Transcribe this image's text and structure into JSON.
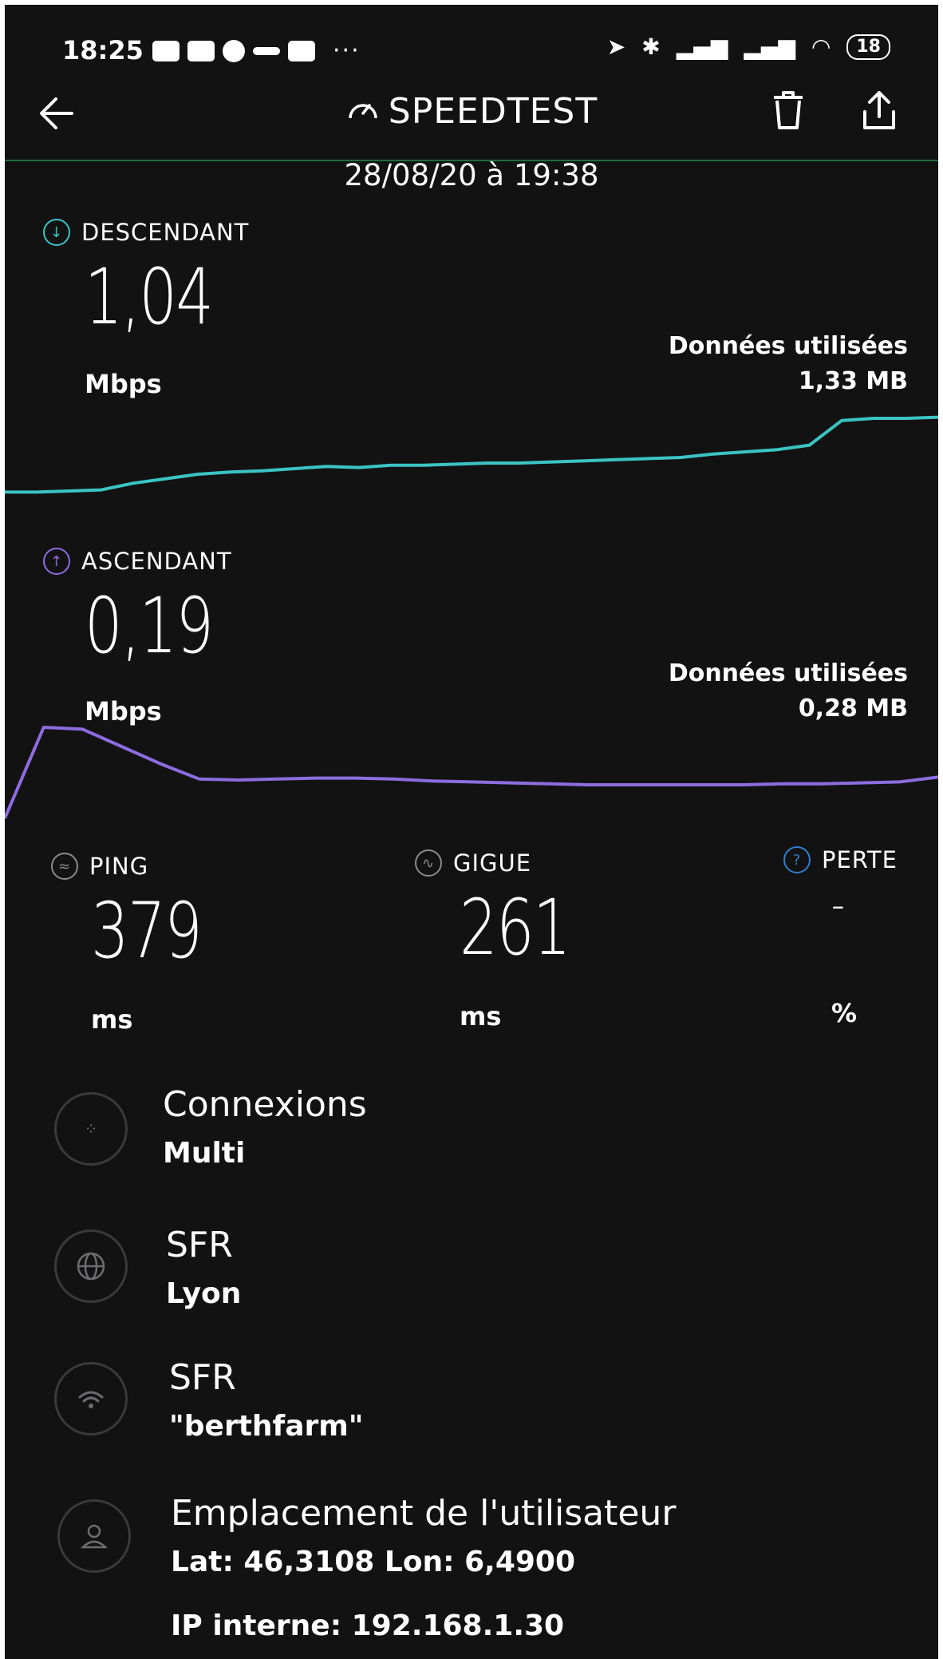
{
  "status_bar": {
    "time": "18:25",
    "notification_icons": [
      "message-icon",
      "youtube-icon",
      "app-icon",
      "app-icon",
      "gmail-icon"
    ],
    "more": "···",
    "right_icons": [
      "location-icon",
      "bluetooth-icon",
      "signal-icon",
      "signal-icon",
      "wifi-icon"
    ],
    "battery": "18"
  },
  "header": {
    "title": "SPEEDTEST",
    "date": "28/08/20 à 19:38"
  },
  "download": {
    "label": "DESCENDANT",
    "value": "1,04",
    "unit": "Mbps",
    "data_used_label": "Données utilisées",
    "data_used_value": "1,33 MB",
    "color": "#3bc4c4"
  },
  "upload": {
    "label": "ASCENDANT",
    "value": "0,19",
    "unit": "Mbps",
    "data_used_label": "Données utilisées",
    "data_used_value": "0,28 MB",
    "color": "#8e6ce0"
  },
  "ping": {
    "label": "PING",
    "value": "379",
    "unit": "ms"
  },
  "jitter": {
    "label": "GIGUE",
    "value": "261",
    "unit": "ms"
  },
  "loss": {
    "label": "PERTE",
    "value": "-",
    "unit": "%"
  },
  "info_rows": [
    {
      "icon": "connections-icon",
      "title": "Connexions",
      "subtitle": "Multi"
    },
    {
      "icon": "globe-icon",
      "title": "SFR",
      "subtitle": "Lyon"
    },
    {
      "icon": "wifi-icon",
      "title": "SFR",
      "subtitle": "\"berthfarm\""
    },
    {
      "icon": "user-icon",
      "title": "Emplacement de l'utilisateur",
      "subtitle": "Lat: 46,3108 Lon: 6,4900"
    }
  ],
  "internal_ip": "IP interne: 192.168.1.30",
  "chart_data": [
    {
      "type": "line",
      "series": [
        {
          "values": [
            0.14,
            0.14,
            0.15,
            0.16,
            0.22,
            0.26,
            0.3,
            0.32,
            0.33,
            0.35,
            0.37,
            0.36,
            0.38,
            0.38,
            0.39,
            0.4,
            0.4,
            0.41,
            0.42,
            0.43,
            0.44,
            0.45,
            0.48,
            0.5,
            0.52,
            0.56,
            0.78,
            0.8,
            0.8,
            0.81
          ]
        }
      ]
    },
    {
      "type": "line",
      "series": [
        {
          "values": [
            0.05,
            1.0,
            0.98,
            0.8,
            0.62,
            0.46,
            0.45,
            0.46,
            0.47,
            0.47,
            0.46,
            0.44,
            0.43,
            0.42,
            0.41,
            0.4,
            0.4,
            0.4,
            0.4,
            0.4,
            0.41,
            0.41,
            0.42,
            0.43,
            0.48
          ]
        }
      ]
    }
  ]
}
